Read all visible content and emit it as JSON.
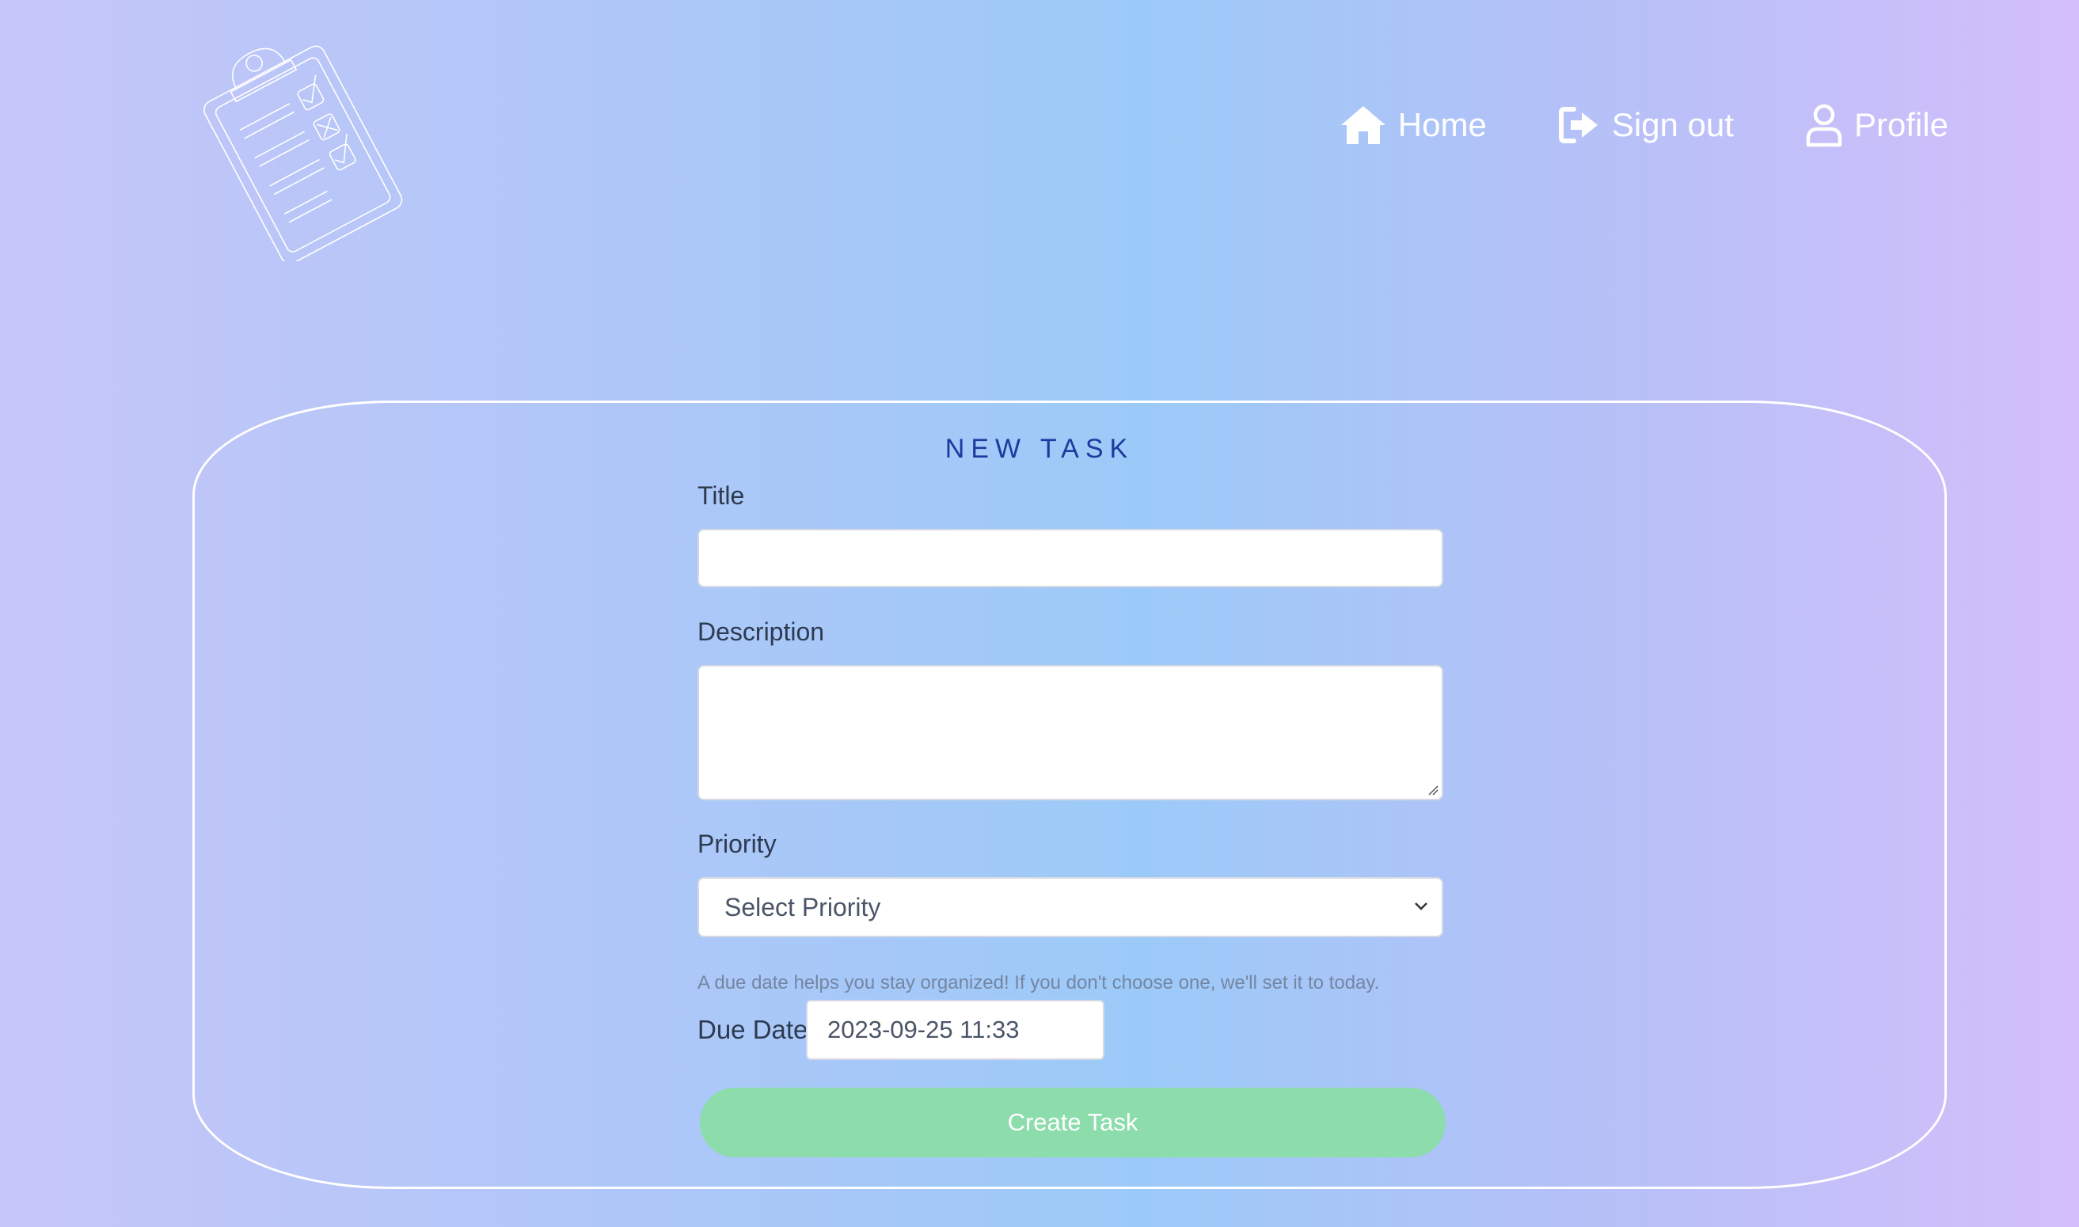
{
  "nav": {
    "home": "Home",
    "sign_out": "Sign out",
    "profile": "Profile"
  },
  "form": {
    "heading": "NEW TASK",
    "title_label": "Title",
    "title_value": "",
    "description_label": "Description",
    "description_value": "",
    "priority_label": "Priority",
    "priority_selected": "Select Priority",
    "due_hint": "A due date helps you stay organized! If you don't choose one, we'll set it to today.",
    "due_label": "Due Date",
    "due_value": "2023-09-25 11:33",
    "submit_label": "Create Task"
  },
  "icons": {
    "logo": "clipboard-checklist-icon",
    "home": "house-icon",
    "sign_out": "sign-out-arrow-icon",
    "profile": "user-icon"
  },
  "colors": {
    "heading": "#1f3a9e",
    "submit_button": "#8cdcac"
  }
}
